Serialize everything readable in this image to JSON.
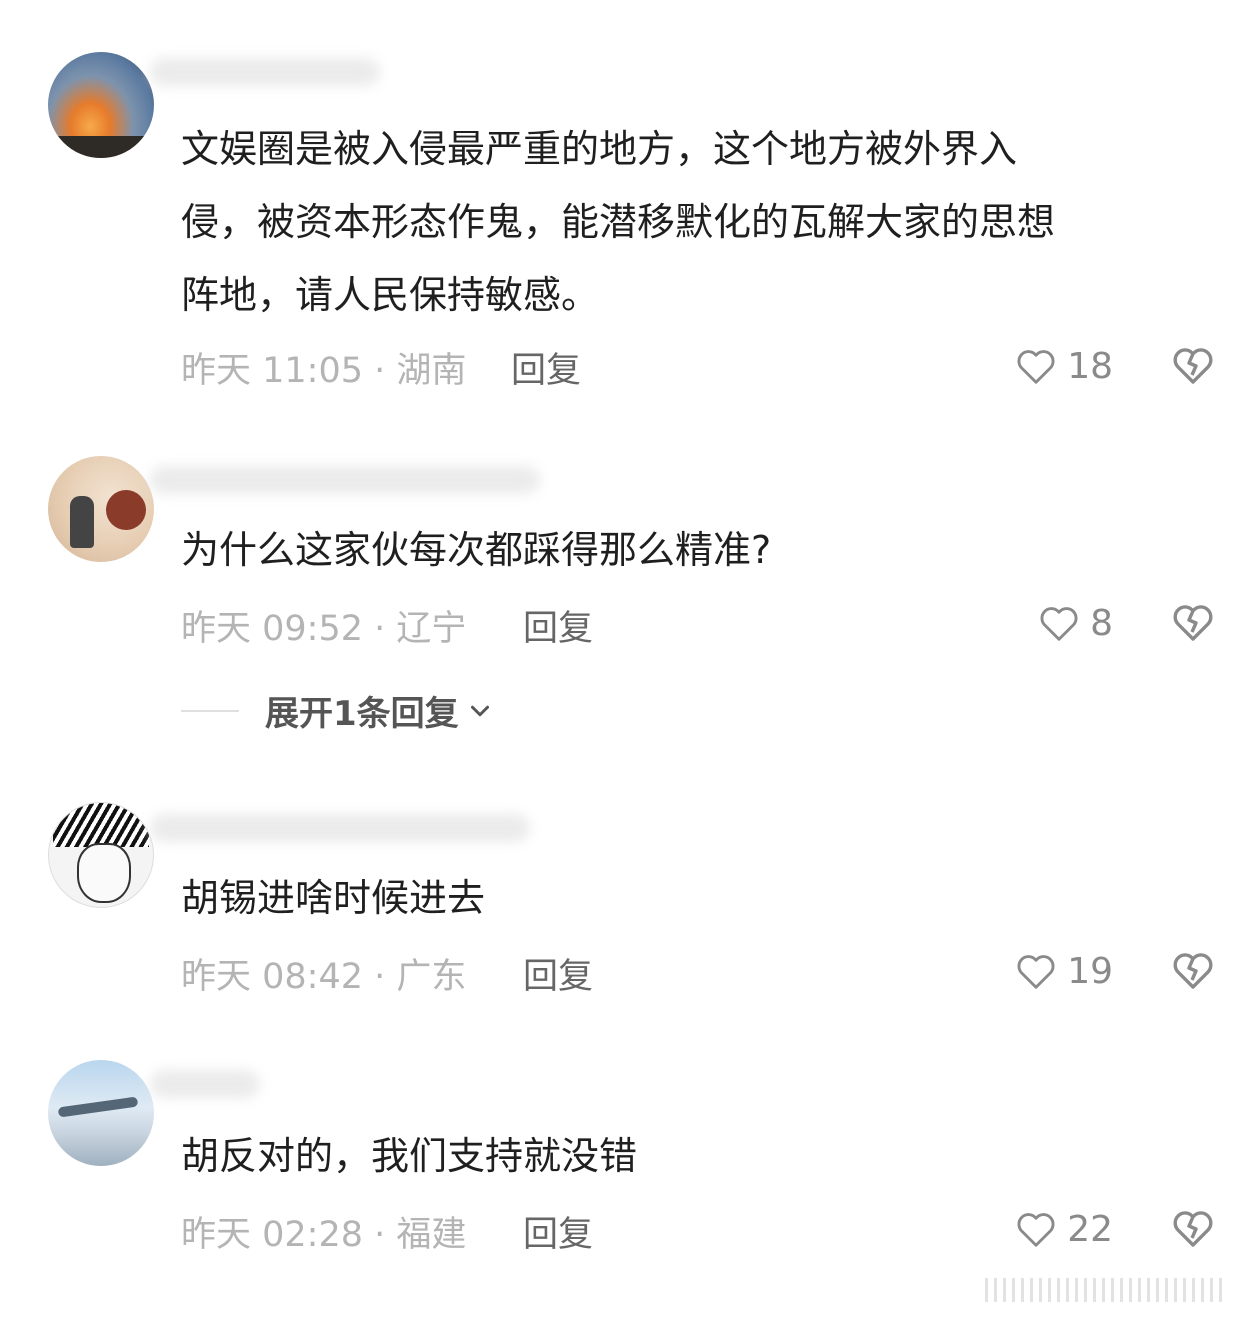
{
  "comments": [
    {
      "text": "文娱圈是被入侵最严重的地方，这个地方被外界入\n侵，被资本形态作鬼，能潜移默化的瓦解大家的思想\n阵地，请人民保持敏感。",
      "meta": "昨天 11:05 · 湖南",
      "reply_label": "回复",
      "likes": "18"
    },
    {
      "text": "为什么这家伙每次都踩得那么精准?",
      "meta": "昨天 09:52 · 辽宁",
      "reply_label": "回复",
      "likes": "8",
      "expand_label": "展开1条回复"
    },
    {
      "text": "胡锡进啥时候进去",
      "meta": "昨天 08:42 · 广东",
      "reply_label": "回复",
      "likes": "19"
    },
    {
      "text": "胡反对的，我们支持就没错",
      "meta": "昨天 02:28 · 福建",
      "reply_label": "回复",
      "likes": "22"
    }
  ],
  "icons": {
    "like": "heart-outline-icon",
    "dislike": "broken-heart-icon",
    "expand": "chevron-down-icon"
  },
  "colors": {
    "meta_gray": "#b4b4b4",
    "icon_gray": "#8a8a8a"
  }
}
